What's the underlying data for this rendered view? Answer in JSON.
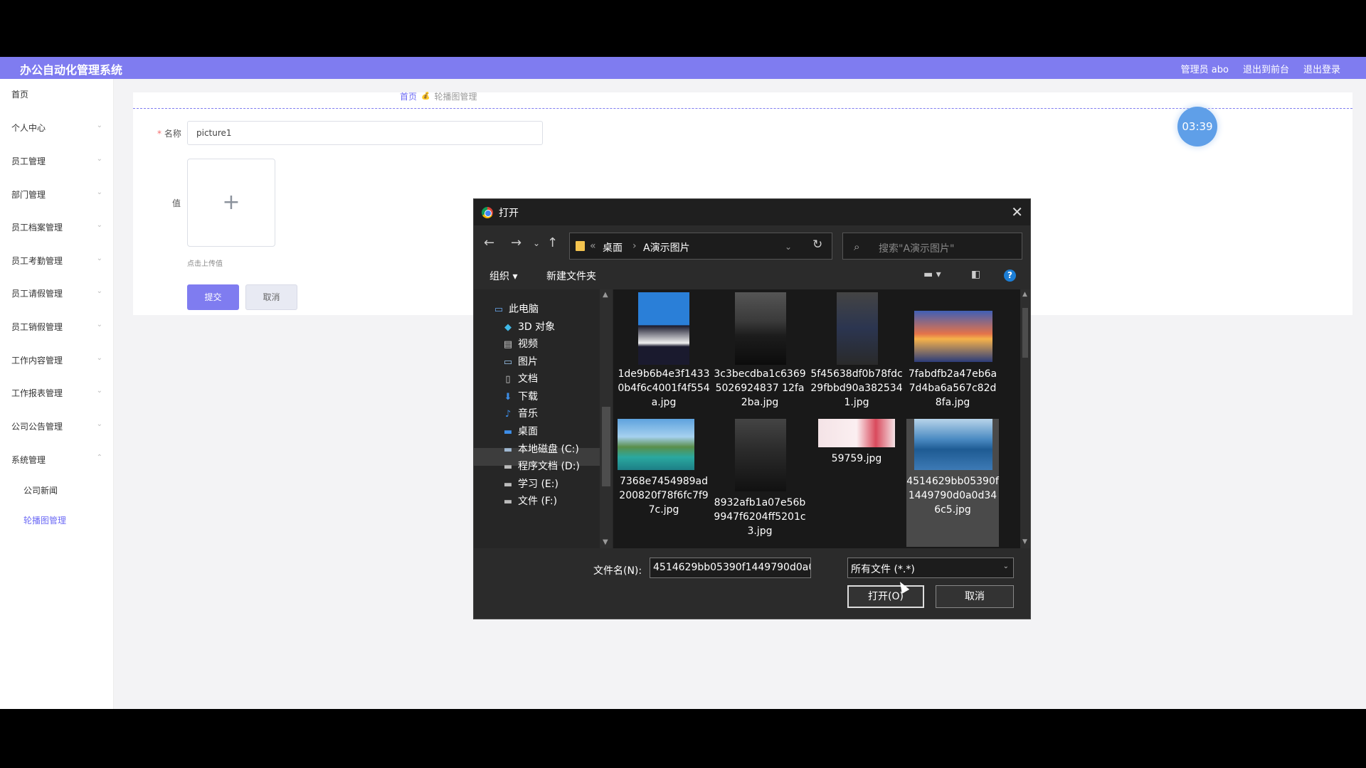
{
  "app": {
    "title": "办公自动化管理系统",
    "user": "管理员 abo",
    "to_front": "退出到前台",
    "logout": "退出登录"
  },
  "sidebar": {
    "items": [
      {
        "label": "首页",
        "chevron": ""
      },
      {
        "label": "个人中心",
        "chevron": "⌄"
      },
      {
        "label": "员工管理",
        "chevron": "⌄"
      },
      {
        "label": "部门管理",
        "chevron": "⌄"
      },
      {
        "label": "员工档案管理",
        "chevron": "⌄"
      },
      {
        "label": "员工考勤管理",
        "chevron": "⌄"
      },
      {
        "label": "员工请假管理",
        "chevron": "⌄"
      },
      {
        "label": "员工销假管理",
        "chevron": "⌄"
      },
      {
        "label": "工作内容管理",
        "chevron": "⌄"
      },
      {
        "label": "工作报表管理",
        "chevron": "⌄"
      },
      {
        "label": "公司公告管理",
        "chevron": "⌄"
      },
      {
        "label": "系统管理",
        "chevron": "⌃"
      }
    ],
    "sub_items": [
      {
        "label": "公司新闻"
      },
      {
        "label": "轮播图管理"
      }
    ]
  },
  "breadcrumb": {
    "home": "首页",
    "sep": "💰",
    "current": "轮播图管理"
  },
  "form": {
    "name_req": "*",
    "name_label": "名称",
    "name_value": "picture1",
    "value_label": "值",
    "upload_plus": "+",
    "upload_hint": "点击上传值",
    "submit": "提交",
    "cancel": "取消"
  },
  "timer": "03:39",
  "dialog": {
    "title": "打开",
    "close": "✕",
    "nav": {
      "back": "←",
      "forward": "→",
      "recent": "⌄",
      "up": "↑"
    },
    "address": {
      "prefix": "«",
      "seg1": "桌面",
      "sep": "›",
      "seg2": "A演示图片",
      "dropdown": "⌄",
      "refresh": "↻"
    },
    "search_placeholder": "搜索\"A演示图片\"",
    "toolbar": {
      "organize": "组织 ▾",
      "new_folder": "新建文件夹",
      "view": "▬ ▾",
      "pane": "◧",
      "help": "?"
    },
    "tree": [
      {
        "label": "此电脑",
        "icon": "💻"
      },
      {
        "label": "3D 对象",
        "icon": "◆"
      },
      {
        "label": "视频",
        "icon": "▤"
      },
      {
        "label": "图片",
        "icon": "▭"
      },
      {
        "label": "文档",
        "icon": "▯"
      },
      {
        "label": "下载",
        "icon": "⬇"
      },
      {
        "label": "音乐",
        "icon": "♪"
      },
      {
        "label": "桌面",
        "icon": "▬"
      },
      {
        "label": "本地磁盘 (C:)",
        "icon": "▬"
      },
      {
        "label": "程序文档 (D:)",
        "icon": "▬"
      },
      {
        "label": "学习 (E:)",
        "icon": "▬"
      },
      {
        "label": "文件 (F:)",
        "icon": "▬"
      }
    ],
    "files": [
      {
        "name": "1de9b6b4e3f14330b4f6c4001f4f554a.jpg"
      },
      {
        "name": "3c3becdba1c63695026924837 12fa2ba.jpg"
      },
      {
        "name": "5f45638df0b78fdc29fbbd90a3825341.jpg"
      },
      {
        "name": "7fabdfb2a47eb6a7d4ba6a567c82d8fa.jpg"
      },
      {
        "name": "7368e7454989ad200820f78f6fc7f97c.jpg"
      },
      {
        "name": "8932afb1a07e56b9947f6204ff5201c3.jpg"
      },
      {
        "name": "59759.jpg"
      },
      {
        "name": "4514629bb05390f1449790d0a0d346c5.jpg"
      }
    ],
    "filename_label": "文件名(N):",
    "filename_value": "4514629bb05390f1449790d0a0",
    "filetype": "所有文件 (*.*)",
    "open": "打开(O)",
    "cancel": "取消"
  }
}
